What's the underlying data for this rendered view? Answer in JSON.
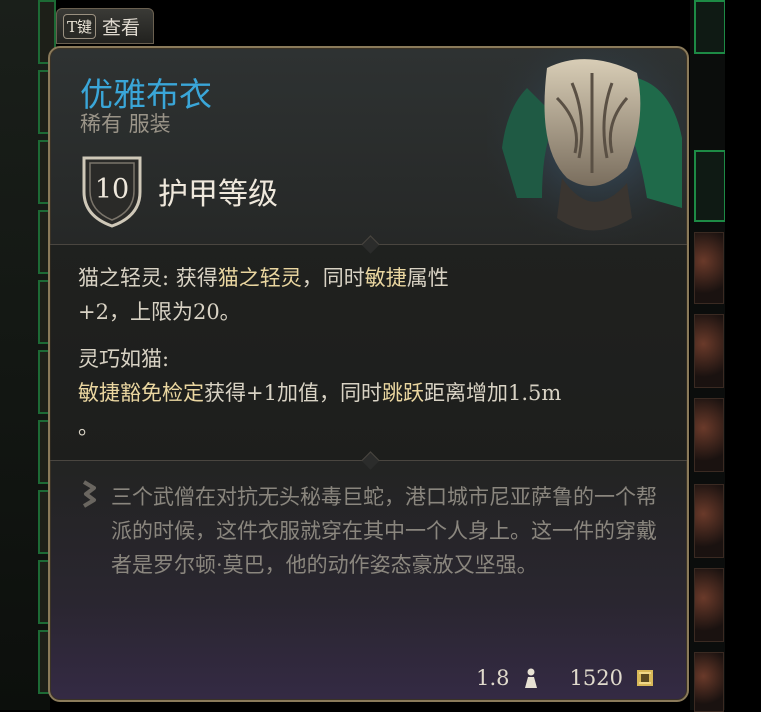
{
  "tab": {
    "key": "T键",
    "label": "查看"
  },
  "item": {
    "name": "优雅布衣",
    "rarity_type": "稀有 服装",
    "armor_class": "10",
    "armor_label": "护甲等级"
  },
  "passives": [
    {
      "line1_a": "猫之轻灵: 获得",
      "line1_b": "猫之轻灵",
      "line1_c": "，同时",
      "line1_d": "敏捷",
      "line1_e": "属性",
      "line2": "+2，上限为20。"
    },
    {
      "title": "灵巧如猫:",
      "l_a": "敏捷",
      "l_b": "豁免检定",
      "l_c": "获得+1加值，同时",
      "l_d": "跳跃",
      "l_e": "距离增加1.5m",
      "l_f": "。"
    }
  ],
  "description": "三个武僧在对抗无头秘毒巨蛇，港口城市尼亚萨鲁的一个帮派的时候，这件衣服就穿在其中一个人身上。这一件的穿戴者是罗尔顿·莫巴，他的动作姿态豪放又坚强。",
  "footer": {
    "weight": "1.8",
    "weight_icon": "weight-icon",
    "price": "1520",
    "price_icon": "gold-icon"
  },
  "colors": {
    "title": "#3aa6d8",
    "highlight": "#ead6a0",
    "border": "#8a7a5a"
  }
}
